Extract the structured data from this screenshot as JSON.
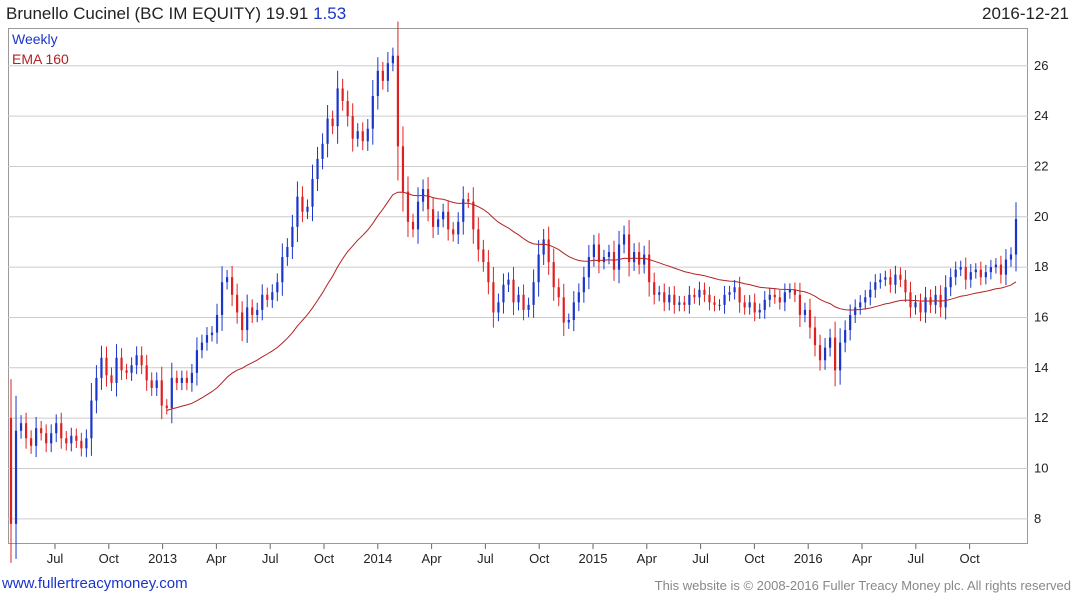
{
  "header": {
    "title": "Brunello Cucinel (BC IM EQUITY) 19.91",
    "change": "1.53",
    "date": "2016-12-21"
  },
  "legend": {
    "frequency": "Weekly",
    "indicator": "EMA 160"
  },
  "footer": {
    "site": "www.fullertreacymoney.com",
    "copyright": "This website is © 2008-2016 Fuller Treacy Money plc. All rights reserved"
  },
  "colors": {
    "up": "#1a35c9",
    "down": "#e02020",
    "ema": "#b22222",
    "grid": "#cccccc"
  },
  "chart_data": {
    "type": "candlestick",
    "frequency": "weekly",
    "ylim": [
      7,
      27.5
    ],
    "yticks": [
      8,
      10,
      12,
      14,
      16,
      18,
      20,
      22,
      24,
      26
    ],
    "xticks": [
      "Jul",
      "Oct",
      "2013",
      "Apr",
      "Jul",
      "Oct",
      "2014",
      "Apr",
      "Jul",
      "Oct",
      "2015",
      "Apr",
      "Jul",
      "Oct",
      "2016",
      "Apr",
      "Jul",
      "Oct"
    ],
    "grid": true,
    "close_weekly": [
      7.8,
      11.5,
      11.8,
      11.2,
      10.9,
      11.6,
      11.4,
      11.0,
      11.4,
      11.8,
      11.2,
      11.0,
      11.3,
      11.1,
      10.8,
      11.2,
      12.7,
      13.6,
      14.4,
      13.7,
      13.4,
      14.4,
      13.9,
      13.8,
      14.1,
      14.5,
      14.1,
      13.5,
      13.2,
      13.5,
      12.5,
      12.4,
      13.6,
      13.4,
      13.6,
      13.4,
      13.8,
      14.7,
      15.0,
      15.3,
      15.4,
      16.1,
      17.4,
      17.6,
      16.9,
      16.2,
      15.5,
      16.4,
      16.1,
      16.3,
      16.9,
      16.7,
      17.0,
      17.4,
      18.4,
      18.8,
      19.6,
      20.8,
      20.2,
      20.4,
      21.5,
      22.3,
      22.9,
      23.9,
      23.6,
      25.1,
      24.6,
      24.0,
      23.1,
      23.4,
      23.0,
      23.5,
      24.8,
      25.8,
      25.4,
      26.1,
      26.4,
      22.8,
      21.0,
      19.8,
      19.5,
      20.6,
      21.1,
      20.3,
      19.6,
      19.9,
      20.2,
      19.5,
      19.3,
      19.8,
      20.7,
      20.6,
      19.5,
      18.7,
      18.2,
      17.4,
      16.2,
      16.6,
      17.3,
      17.5,
      16.6,
      16.9,
      16.3,
      16.5,
      17.4,
      18.5,
      19.1,
      18.2,
      17.2,
      16.8,
      15.8,
      15.9,
      16.6,
      17.0,
      17.6,
      18.4,
      18.9,
      18.2,
      18.4,
      18.6,
      17.9,
      18.9,
      19.3,
      18.2,
      18.6,
      18.1,
      18.5,
      17.4,
      16.9,
      17.0,
      16.6,
      16.9,
      16.5,
      16.6,
      16.5,
      16.9,
      16.8,
      17.1,
      16.9,
      16.6,
      16.5,
      16.5,
      16.9,
      17.0,
      17.2,
      16.6,
      16.4,
      16.6,
      16.2,
      16.3,
      16.7,
      16.9,
      16.8,
      16.6,
      17.0,
      17.1,
      16.9,
      16.1,
      16.3,
      15.6,
      14.9,
      14.3,
      14.8,
      15.2,
      13.9,
      15.0,
      15.5,
      16.1,
      16.4,
      16.6,
      16.8,
      17.1,
      17.4,
      17.5,
      17.6,
      17.3,
      17.7,
      17.5,
      17.0,
      16.4,
      16.6,
      16.2,
      16.8,
      16.5,
      16.9,
      16.4,
      17.2,
      17.6,
      17.9,
      18.0,
      17.5,
      17.8,
      17.9,
      17.6,
      17.8,
      18.0,
      18.1,
      17.7,
      18.3,
      18.5,
      19.91
    ],
    "ema_start_index": 31,
    "ema_start_value": 12.3
  }
}
